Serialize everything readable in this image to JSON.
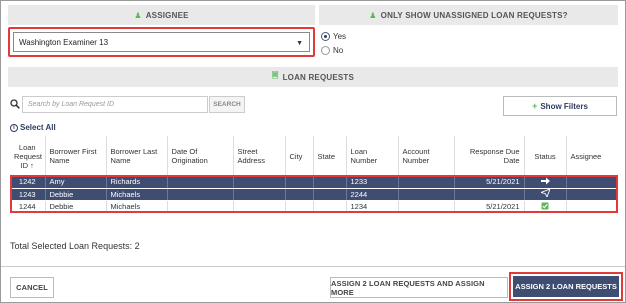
{
  "assignee_section": {
    "header": "ASSIGNEE",
    "selected_value": "Washington Examiner 13"
  },
  "unassigned_section": {
    "header": "ONLY SHOW UNASSIGNED LOAN REQUESTS?",
    "options": [
      {
        "label": "Yes",
        "selected": true
      },
      {
        "label": "No",
        "selected": false
      }
    ]
  },
  "loan_requests_section": {
    "header": "LOAN REQUESTS"
  },
  "search": {
    "placeholder": "Search by Loan Request ID",
    "button_label": "SEARCH"
  },
  "filters_button": "Show Filters",
  "select_all_label": "Select All",
  "table": {
    "columns": [
      "Loan Request ID",
      "Borrower First Name",
      "Borrower Last Name",
      "Date Of Origination",
      "Street Address",
      "City",
      "State",
      "Loan Number",
      "Account Number",
      "Response Due Date",
      "Status",
      "Assignee"
    ],
    "rows": [
      {
        "id": "1242",
        "first": "Amy",
        "last": "Richards",
        "origination": "",
        "street": "",
        "city": "",
        "state": "",
        "loan_number": "1233",
        "account": "",
        "due": "5/21/2021",
        "status_icon": "arrow-right-icon",
        "assignee": "",
        "selected": true
      },
      {
        "id": "1243",
        "first": "Debbie",
        "last": "Michaels",
        "origination": "",
        "street": "",
        "city": "",
        "state": "",
        "loan_number": "2244",
        "account": "",
        "due": "",
        "status_icon": "send-icon",
        "assignee": "",
        "selected": true
      },
      {
        "id": "1244",
        "first": "Debbie",
        "last": "Michaels",
        "origination": "",
        "street": "",
        "city": "",
        "state": "",
        "loan_number": "1234",
        "account": "",
        "due": "5/21/2021",
        "status_icon": "check-square-icon",
        "assignee": "",
        "selected": false
      }
    ]
  },
  "total_label": "Total Selected Loan Requests: 2",
  "footer": {
    "cancel": "CANCEL",
    "assign_more": "ASSIGN 2 LOAN REQUESTS AND ASSIGN MORE",
    "assign": "ASSIGN 2 LOAN REQUESTS"
  },
  "colors": {
    "accent_navy": "#3f4d72",
    "highlight_red": "#e23a3a",
    "icon_green": "#5cb85c"
  }
}
